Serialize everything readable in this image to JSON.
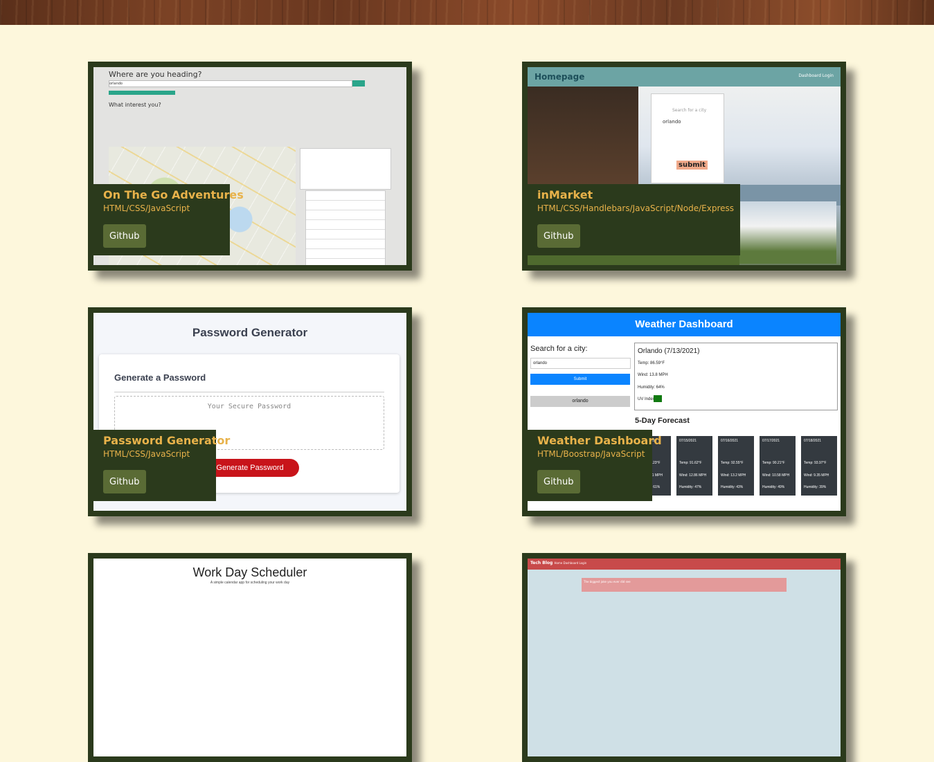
{
  "projects": [
    {
      "title": "On The Go Adventures",
      "tech": "HTML/CSS/JavaScript",
      "button": "Github",
      "screenshot": {
        "heading": "Where are you heading?",
        "search_value": "orlando",
        "question": "What interest you?"
      }
    },
    {
      "title": "inMarket",
      "tech": "HTML/CSS/Handlebars/JavaScript/Node/Express",
      "button": "Github",
      "screenshot": {
        "brand": "Homepage",
        "nav_links": "Dashboard   Login",
        "search_label": "Search for a city",
        "search_value": "orlando",
        "submit": "submit"
      }
    },
    {
      "title": "Password Generator",
      "tech": "HTML/CSS/JavaScript",
      "button": "Github",
      "screenshot": {
        "heading": "Password Generator",
        "subheading": "Generate a Password",
        "placeholder": "Your Secure Password",
        "generate": "Generate Password"
      }
    },
    {
      "title": "Weather Dashboard",
      "tech": "HTML/Boostrap/JavaScript",
      "button": "Github",
      "screenshot": {
        "header": "Weather Dashboard",
        "search_label": "Search for a city:",
        "search_value": "orlando",
        "submit": "Submit",
        "history": "orlando",
        "current_title": "Orlando (7/13/2021)",
        "temp": "Temp: 86.59°F",
        "wind": "Wind: 13.8 MPH",
        "humidity": "Humidity: 64%",
        "uv": "UV Index:",
        "forecast_title": "5-Day Forecast",
        "forecast": [
          {
            "date": "07/14/2021",
            "temp": "Temp: 89.23°F",
            "wind": "Wind: 11.1 MPH",
            "humidity": "Humidity: 61%"
          },
          {
            "date": "07/15/2021",
            "temp": "Temp: 91.62°F",
            "wind": "Wind: 12.86 MPH",
            "humidity": "Humidity: 47%"
          },
          {
            "date": "07/16/2021",
            "temp": "Temp: 92.55°F",
            "wind": "Wind: 13.2 MPH",
            "humidity": "Humidity: 43%"
          },
          {
            "date": "07/17/2021",
            "temp": "Temp: 90.21°F",
            "wind": "Wind: 10.58 MPH",
            "humidity": "Humidity: 49%"
          },
          {
            "date": "07/18/2021",
            "temp": "Temp: 93.97°F",
            "wind": "Wind: 9.35 MPH",
            "humidity": "Humidity: 39%"
          }
        ]
      }
    },
    {
      "screenshot": {
        "heading": "Work Day Scheduler",
        "subtitle": "A simple calendar app for scheduling your work day"
      }
    },
    {
      "screenshot": {
        "brand": "Tech Blog",
        "nav_links": "Home  Dashboard  Login",
        "post_title": "The biggest joke you ever did see"
      }
    }
  ],
  "colors": {
    "page_background": "#fdf7dc",
    "card_frame": "#2b3a1c",
    "accent_text": "#e8b24a",
    "button_bg": "#5a6b35"
  }
}
